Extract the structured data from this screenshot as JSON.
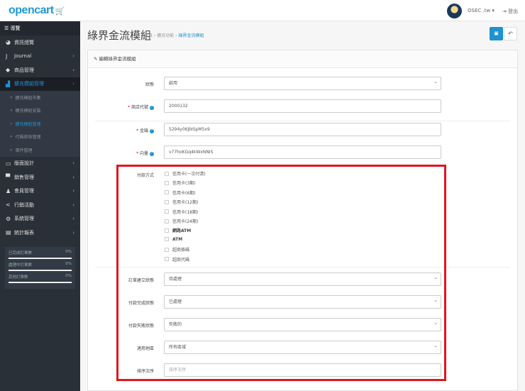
{
  "header": {
    "logo": "opencart",
    "user": "OSEC .tw",
    "logout": "登出"
  },
  "sidebar": {
    "title": "導覽",
    "items": [
      {
        "label": "資訊總覽",
        "icon": "dashboard-icon",
        "glyph": "◕"
      },
      {
        "label": "Journal",
        "icon": "journal-icon",
        "glyph": "J"
      },
      {
        "label": "商品管理",
        "icon": "tags-icon",
        "glyph": "◆"
      },
      {
        "label": "擴充模組管理",
        "icon": "puzzle-icon",
        "glyph": "▟"
      }
    ],
    "subitems": [
      "擴充模組市集",
      "擴充模組安裝",
      "擴充模組管理",
      "代碼修改管理",
      "事件管理"
    ],
    "items2": [
      {
        "label": "版面設計",
        "icon": "desktop-icon",
        "glyph": "▭"
      },
      {
        "label": "銷售管理",
        "icon": "cart-icon",
        "glyph": "▀"
      },
      {
        "label": "會員管理",
        "icon": "user-icon",
        "glyph": "♟"
      },
      {
        "label": "行銷活動",
        "icon": "share-icon",
        "glyph": "<"
      },
      {
        "label": "系統管理",
        "icon": "gear-icon",
        "glyph": "⚙"
      },
      {
        "label": "統計報表",
        "icon": "bar-chart-icon",
        "glyph": "▤"
      }
    ],
    "stats": [
      {
        "label": "已完成訂單數",
        "value": "0%"
      },
      {
        "label": "處理中訂單數",
        "value": "0%"
      },
      {
        "label": "其他訂單數",
        "value": "0%"
      }
    ]
  },
  "page": {
    "title": "綠界金流模組",
    "breadcrumb": [
      "首頁",
      "擴充功能",
      "綠界金流模組"
    ]
  },
  "panel": {
    "heading": "編輯綠界金流模組",
    "status": {
      "label": "狀態",
      "value": "啟用"
    },
    "merchant_id": {
      "label": "商店代號",
      "value": "2000132"
    },
    "hash_key": {
      "label": "金鑰",
      "value": "5294y06JbISpM5x9"
    },
    "hash_iv": {
      "label": "向量",
      "value": "v77hoKGq4kWxNNIS"
    },
    "payment_methods": {
      "label": "付款方式",
      "options": [
        "信用卡(一次付清)",
        "信用卡(3期)",
        "信用卡(6期)",
        "信用卡(12期)",
        "信用卡(18期)",
        "信用卡(24期)",
        "網路ATM",
        "ATM",
        "超商條碼",
        "超商代碼"
      ]
    },
    "create_status": {
      "label": "訂單建立狀態",
      "value": "待處理"
    },
    "success_status": {
      "label": "付款完成狀態",
      "value": "已處理"
    },
    "failed_status": {
      "label": "付款失敗狀態",
      "value": "失敗的"
    },
    "geo_zone": {
      "label": "適用地區",
      "value": "所有區域"
    },
    "sort_order": {
      "label": "排序次序",
      "placeholder": "排序次序"
    }
  }
}
